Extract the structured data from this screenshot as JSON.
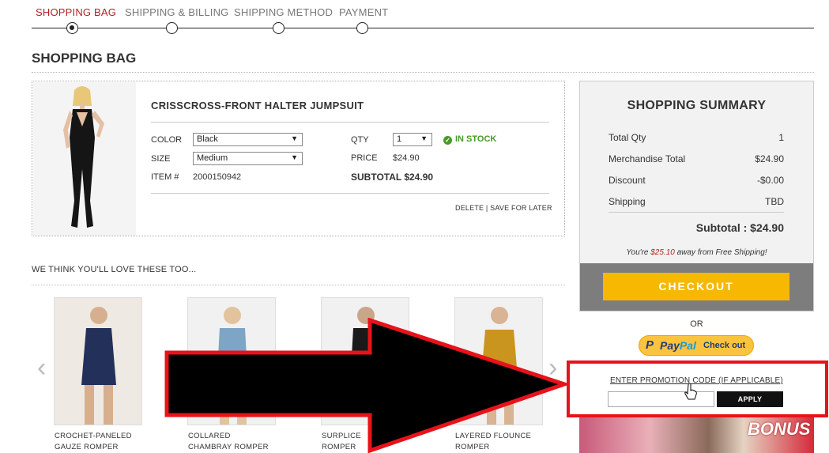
{
  "steps": [
    "SHOPPING BAG",
    "SHIPPING & BILLING",
    "SHIPPING METHOD",
    "PAYMENT"
  ],
  "page_title": "SHOPPING BAG",
  "product": {
    "name": "CRISSCROSS-FRONT HALTER JUMPSUIT",
    "color_label": "COLOR",
    "color_value": "Black",
    "size_label": "SIZE",
    "size_value": "Medium",
    "item_label": "ITEM #",
    "item_value": "2000150942",
    "qty_label": "QTY",
    "qty_value": "1",
    "stock": "IN STOCK",
    "price_label": "PRICE",
    "price_value": "$24.90",
    "subtotal": "SUBTOTAL $24.90",
    "delete": "DELETE",
    "separator": "|",
    "save_later": "SAVE FOR LATER"
  },
  "recommend": {
    "title": "WE THINK YOU'LL LOVE THESE TOO...",
    "items": [
      {
        "line1": "CROCHET-PANELED",
        "line2": "GAUZE ROMPER"
      },
      {
        "line1": "COLLARED",
        "line2": "CHAMBRAY ROMPER"
      },
      {
        "line1": "SURPLICE",
        "line2": "ROMPER"
      },
      {
        "line1": "LAYERED FLOUNCE",
        "line2": "ROMPER"
      }
    ],
    "prev": "‹",
    "next": "›"
  },
  "summary": {
    "title": "SHOPPING SUMMARY",
    "rows": [
      {
        "label": "Total Qty",
        "value": "1"
      },
      {
        "label": "Merchandise Total",
        "value": "$24.90"
      },
      {
        "label": "Discount",
        "value": "-$0.00"
      },
      {
        "label": "Shipping",
        "value": "TBD"
      }
    ],
    "subtotal": "Subtotal : $24.90",
    "free_pre": "You're ",
    "free_amount": "$25.10",
    "free_post": " away from Free Shipping!",
    "checkout": "CHECKOUT",
    "or": "OR",
    "paypal_pay": "Pay",
    "paypal_pal": "Pal",
    "paypal_checkout": "Check out",
    "promo_link": "ENTER PROMOTION CODE (IF APPLICABLE)",
    "apply": "APPLY"
  },
  "banner_text": "BONUS",
  "colors": {
    "accent": "#b32024",
    "checkout": "#f6b800",
    "annotation": "#e8121a",
    "instock": "#4a9a2a"
  }
}
